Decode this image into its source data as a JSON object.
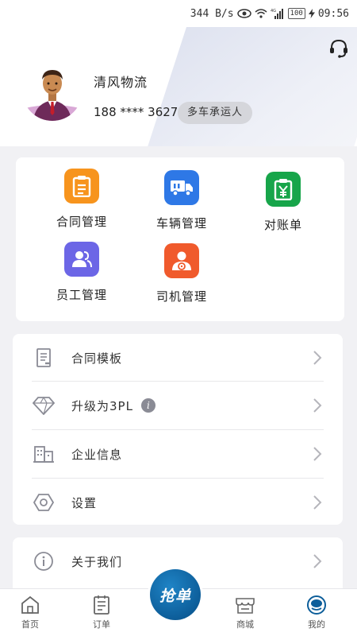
{
  "status_bar": {
    "network_speed": "344 B/s",
    "battery": "100",
    "time": "09:56",
    "icons": [
      "eye-icon",
      "wifi-icon",
      "4g-signal-icon",
      "battery-icon",
      "charging-icon"
    ]
  },
  "profile": {
    "company_name": "清风物流",
    "phone": "188 **** 3627",
    "role_badge": "多车承运人",
    "support_icon": "headset-icon"
  },
  "grid": {
    "items": [
      {
        "label": "合同管理",
        "icon": "contract-icon",
        "color": "#f7941d"
      },
      {
        "label": "车辆管理",
        "icon": "truck-icon",
        "color": "#2e78e6"
      },
      {
        "label": "对账单",
        "icon": "yuan-clipboard-icon",
        "color": "#17a54a"
      },
      {
        "label": "员工管理",
        "icon": "employees-icon",
        "color": "#6c66e6"
      },
      {
        "label": "司机管理",
        "icon": "driver-icon",
        "color": "#f05a2c"
      }
    ]
  },
  "menu": {
    "items": [
      {
        "label": "合同模板",
        "icon": "document-icon"
      },
      {
        "label": "升级为3PL",
        "icon": "diamond-icon",
        "badge": "i"
      },
      {
        "label": "企业信息",
        "icon": "building-icon"
      },
      {
        "label": "设置",
        "icon": "hexagon-settings-icon"
      }
    ],
    "about": {
      "label": "关于我们",
      "icon": "info-circle-icon"
    }
  },
  "bottom_nav": {
    "items": [
      {
        "label": "首页",
        "icon": "home-icon"
      },
      {
        "label": "订单",
        "icon": "order-icon"
      },
      {
        "label": "商城",
        "icon": "store-icon"
      },
      {
        "label": "我的",
        "icon": "profile-icon"
      }
    ],
    "center_button": "抢单",
    "accent": "#0d5e9a"
  }
}
